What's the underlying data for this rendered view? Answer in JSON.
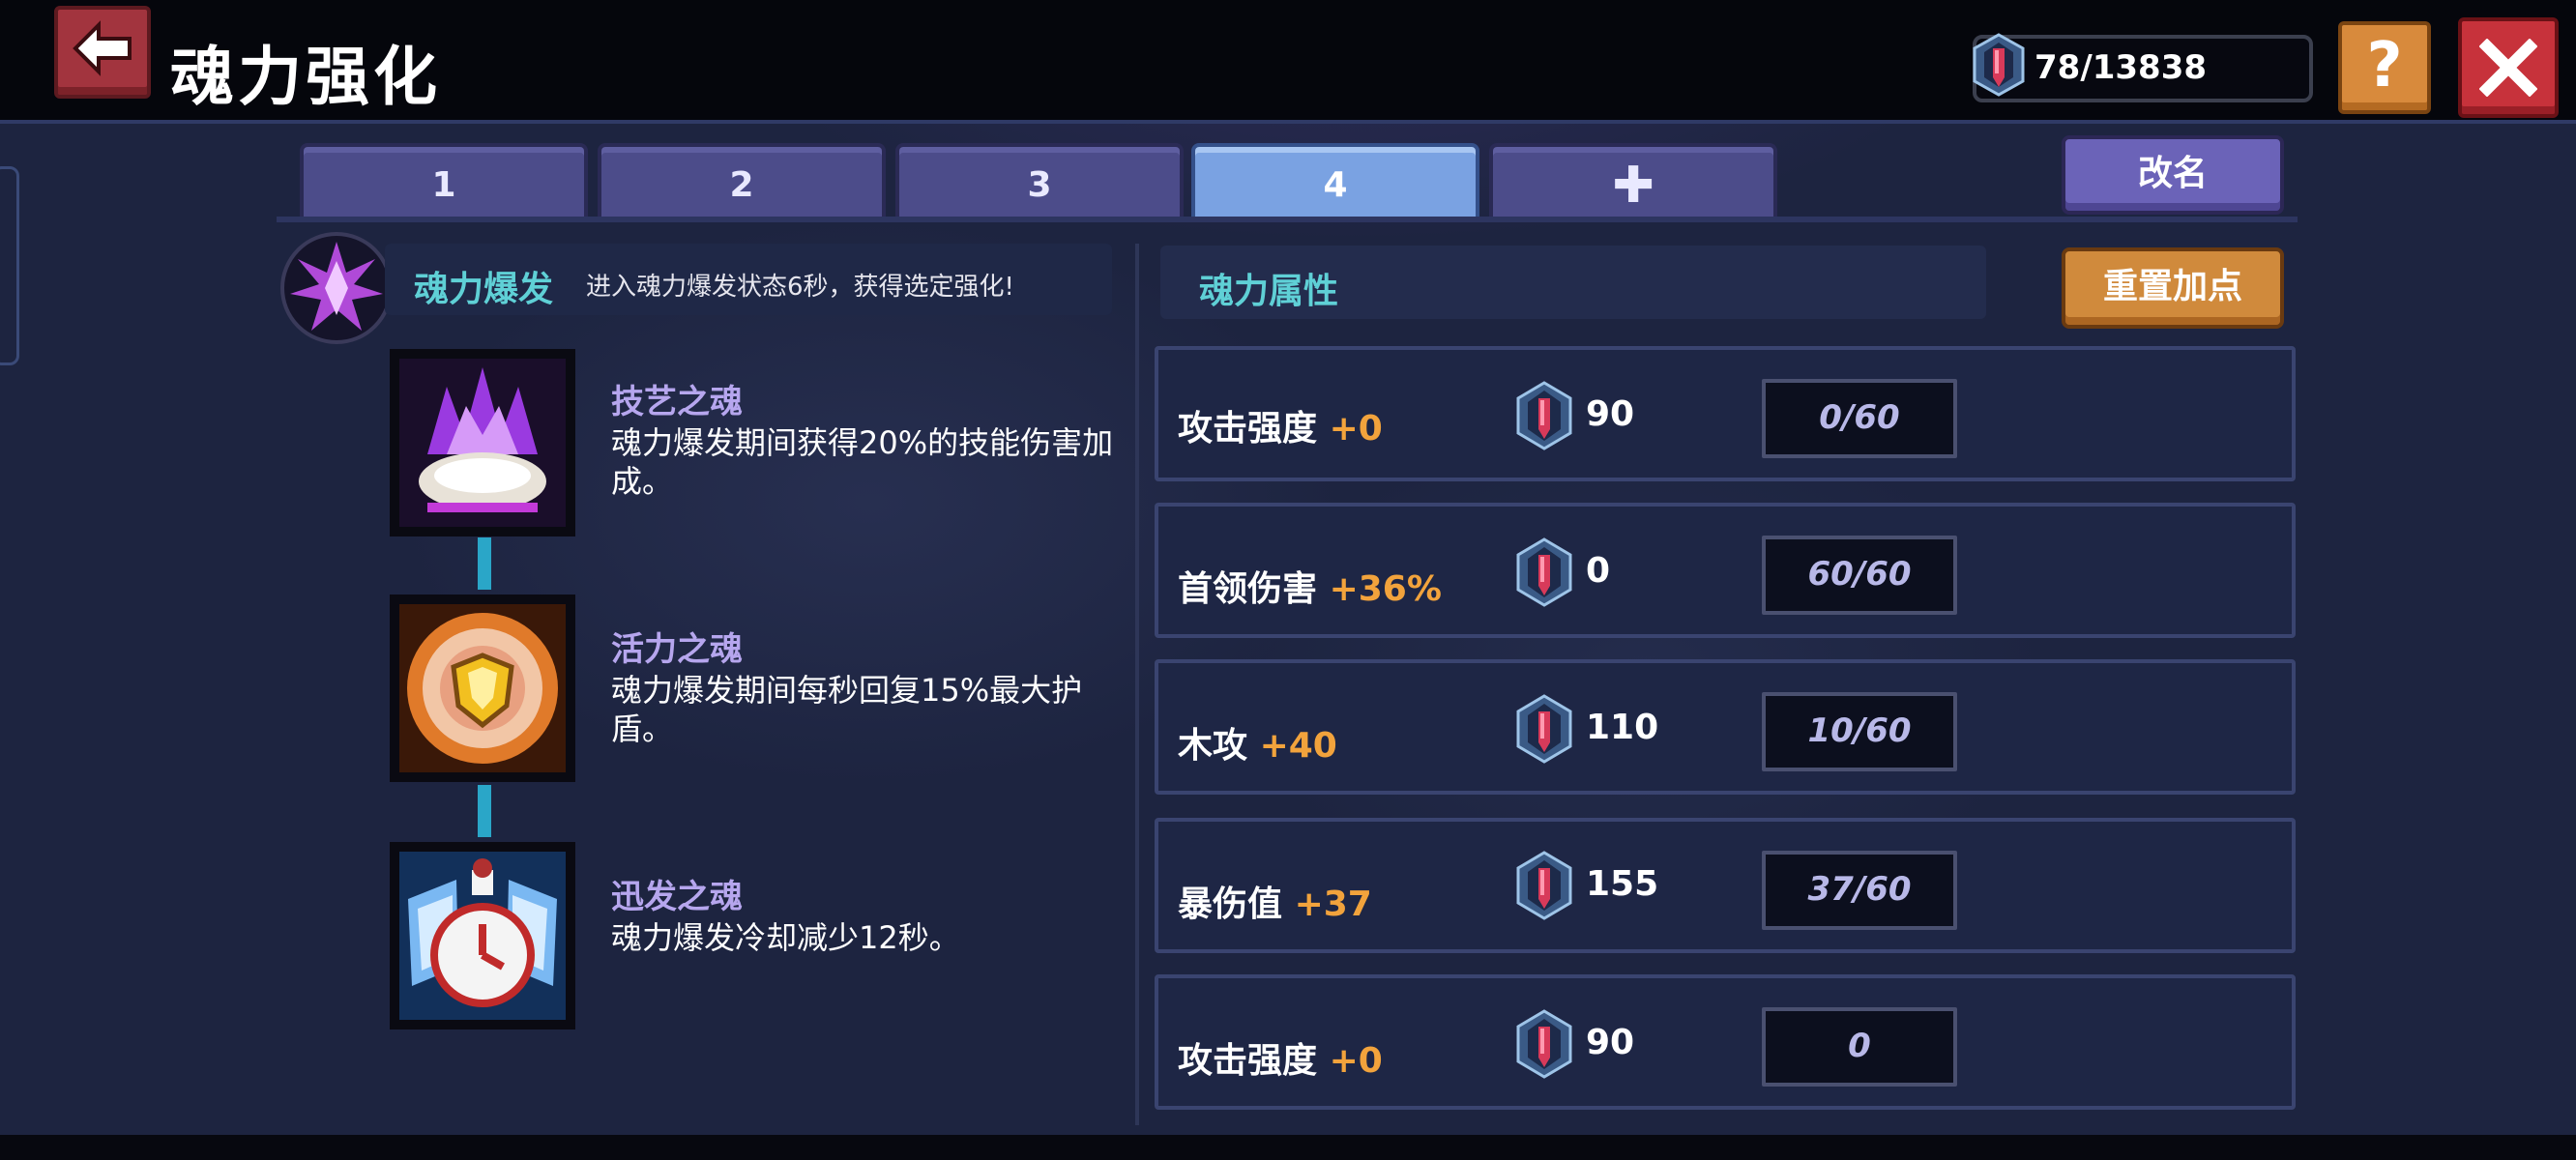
{
  "header": {
    "title": "魂力强化",
    "currency_text": "78/13838",
    "help_label": "?"
  },
  "tabs": [
    {
      "label": "1",
      "active": false
    },
    {
      "label": "2",
      "active": false
    },
    {
      "label": "3",
      "active": false
    },
    {
      "label": "4",
      "active": true
    },
    {
      "label": "✚",
      "active": false
    }
  ],
  "buttons": {
    "rename": "改名",
    "reset": "重置加点"
  },
  "burst": {
    "title": "魂力爆发",
    "desc": "进入魂力爆发状态6秒，获得选定强化!"
  },
  "souls": [
    {
      "name": "技艺之魂",
      "desc": "魂力爆发期间获得20%的技能伤害加成。",
      "icon": "purple-flame-shell-icon"
    },
    {
      "name": "活力之魂",
      "desc": "魂力爆发期间每秒回复15%最大护盾。",
      "icon": "golden-shield-icon"
    },
    {
      "name": "迅发之魂",
      "desc": "魂力爆发冷却减少12秒。",
      "icon": "winged-clock-icon"
    }
  ],
  "attributes": {
    "title": "魂力属性",
    "rows": [
      {
        "name": "攻击强度",
        "bonus": "+0",
        "cost": "90",
        "progress": "0/60"
      },
      {
        "name": "首领伤害",
        "bonus": "+36%",
        "cost": "0",
        "progress": "60/60"
      },
      {
        "name": "木攻",
        "bonus": "+40",
        "cost": "110",
        "progress": "10/60"
      },
      {
        "name": "暴伤值",
        "bonus": "+37",
        "cost": "155",
        "progress": "37/60"
      },
      {
        "name": "攻击强度",
        "bonus": "+0",
        "cost": "90",
        "progress": "0"
      }
    ]
  },
  "colors": {
    "accent_cyan": "#5fd0d6",
    "bonus_orange": "#f2a33c",
    "active_tab": "#7aa2e2"
  }
}
